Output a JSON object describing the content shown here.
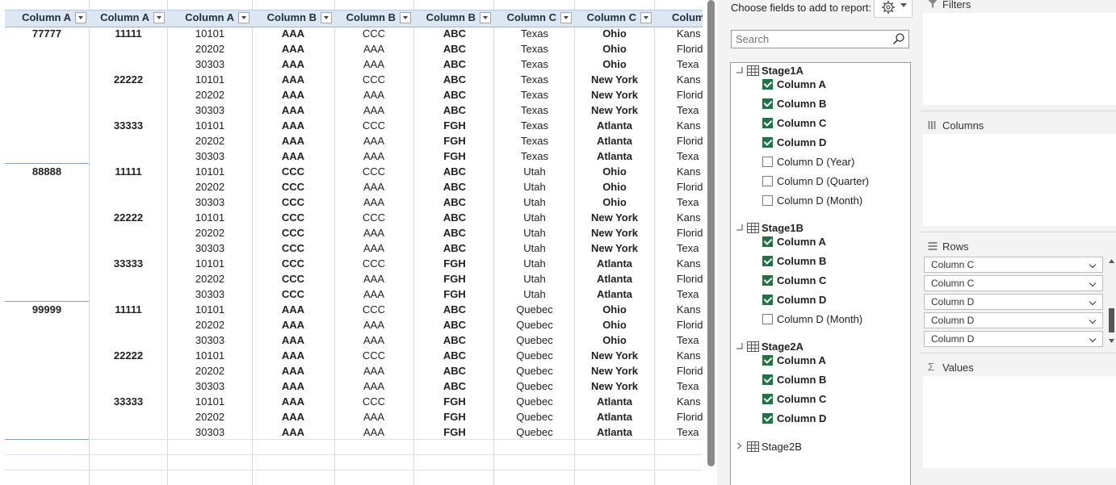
{
  "sheet": {
    "headers": [
      "Column A",
      "Column A",
      "Column A",
      "Column B",
      "Column B",
      "Column B",
      "Column C",
      "Column C",
      "Colum"
    ],
    "groups": [
      {
        "a1": "77777",
        "start": 0
      },
      {
        "a1": "88888",
        "start": 9
      },
      {
        "a1": "99999",
        "start": 18
      }
    ],
    "rows": [
      [
        "",
        "11111",
        "10101",
        "AAA",
        "CCC",
        "ABC",
        "Texas",
        "Ohio",
        "Kans"
      ],
      [
        "",
        "",
        "20202",
        "AAA",
        "AAA",
        "ABC",
        "Texas",
        "Ohio",
        "Florid"
      ],
      [
        "",
        "",
        "30303",
        "AAA",
        "AAA",
        "ABC",
        "Texas",
        "Ohio",
        "Texa"
      ],
      [
        "",
        "22222",
        "10101",
        "AAA",
        "CCC",
        "ABC",
        "Texas",
        "New York",
        "Kans"
      ],
      [
        "",
        "",
        "20202",
        "AAA",
        "AAA",
        "ABC",
        "Texas",
        "New York",
        "Florid"
      ],
      [
        "",
        "",
        "30303",
        "AAA",
        "AAA",
        "ABC",
        "Texas",
        "New York",
        "Texa"
      ],
      [
        "",
        "33333",
        "10101",
        "AAA",
        "CCC",
        "FGH",
        "Texas",
        "Atlanta",
        "Kans"
      ],
      [
        "",
        "",
        "20202",
        "AAA",
        "AAA",
        "FGH",
        "Texas",
        "Atlanta",
        "Florid"
      ],
      [
        "",
        "",
        "30303",
        "AAA",
        "AAA",
        "FGH",
        "Texas",
        "Atlanta",
        "Texa"
      ],
      [
        "",
        "11111",
        "10101",
        "CCC",
        "CCC",
        "ABC",
        "Utah",
        "Ohio",
        "Kans"
      ],
      [
        "",
        "",
        "20202",
        "CCC",
        "AAA",
        "ABC",
        "Utah",
        "Ohio",
        "Florid"
      ],
      [
        "",
        "",
        "30303",
        "CCC",
        "AAA",
        "ABC",
        "Utah",
        "Ohio",
        "Texa"
      ],
      [
        "",
        "22222",
        "10101",
        "CCC",
        "CCC",
        "ABC",
        "Utah",
        "New York",
        "Kans"
      ],
      [
        "",
        "",
        "20202",
        "CCC",
        "AAA",
        "ABC",
        "Utah",
        "New York",
        "Florid"
      ],
      [
        "",
        "",
        "30303",
        "CCC",
        "AAA",
        "ABC",
        "Utah",
        "New York",
        "Texa"
      ],
      [
        "",
        "33333",
        "10101",
        "CCC",
        "CCC",
        "FGH",
        "Utah",
        "Atlanta",
        "Kans"
      ],
      [
        "",
        "",
        "20202",
        "CCC",
        "AAA",
        "FGH",
        "Utah",
        "Atlanta",
        "Florid"
      ],
      [
        "",
        "",
        "30303",
        "CCC",
        "AAA",
        "FGH",
        "Utah",
        "Atlanta",
        "Texa"
      ],
      [
        "",
        "11111",
        "10101",
        "AAA",
        "CCC",
        "ABC",
        "Quebec",
        "Ohio",
        "Kans"
      ],
      [
        "",
        "",
        "20202",
        "AAA",
        "AAA",
        "ABC",
        "Quebec",
        "Ohio",
        "Florid"
      ],
      [
        "",
        "",
        "30303",
        "AAA",
        "AAA",
        "ABC",
        "Quebec",
        "Ohio",
        "Texa"
      ],
      [
        "",
        "22222",
        "10101",
        "AAA",
        "CCC",
        "ABC",
        "Quebec",
        "New York",
        "Kans"
      ],
      [
        "",
        "",
        "20202",
        "AAA",
        "AAA",
        "ABC",
        "Quebec",
        "New York",
        "Florid"
      ],
      [
        "",
        "",
        "30303",
        "AAA",
        "AAA",
        "ABC",
        "Quebec",
        "New York",
        "Texa"
      ],
      [
        "",
        "33333",
        "10101",
        "AAA",
        "CCC",
        "FGH",
        "Quebec",
        "Atlanta",
        "Kans"
      ],
      [
        "",
        "",
        "20202",
        "AAA",
        "AAA",
        "FGH",
        "Quebec",
        "Atlanta",
        "Florid"
      ],
      [
        "",
        "",
        "30303",
        "AAA",
        "AAA",
        "FGH",
        "Quebec",
        "Atlanta",
        "Texa"
      ]
    ]
  },
  "fieldlist": {
    "choose_label": "Choose fields to add to report:",
    "search_placeholder": "Search",
    "tables": [
      {
        "name": "Stage1A",
        "expanded": true,
        "fields": [
          {
            "label": "Column A",
            "checked": true
          },
          {
            "label": "Column B",
            "checked": true
          },
          {
            "label": "Column C",
            "checked": true
          },
          {
            "label": "Column D",
            "checked": true
          },
          {
            "label": "Column D (Year)",
            "checked": false
          },
          {
            "label": "Column D (Quarter)",
            "checked": false
          },
          {
            "label": "Column D (Month)",
            "checked": false
          }
        ]
      },
      {
        "name": "Stage1B",
        "expanded": true,
        "fields": [
          {
            "label": "Column A",
            "checked": true
          },
          {
            "label": "Column B",
            "checked": true
          },
          {
            "label": "Column C",
            "checked": true
          },
          {
            "label": "Column D",
            "checked": true
          },
          {
            "label": "Column D (Month)",
            "checked": false
          }
        ]
      },
      {
        "name": "Stage2A",
        "expanded": true,
        "fields": [
          {
            "label": "Column A",
            "checked": true
          },
          {
            "label": "Column B",
            "checked": true
          },
          {
            "label": "Column C",
            "checked": true
          },
          {
            "label": "Column D",
            "checked": true
          }
        ]
      },
      {
        "name": "Stage2B",
        "expanded": false,
        "fields": []
      }
    ]
  },
  "areas": {
    "filters_label": "Filters",
    "columns_label": "Columns",
    "rows_label": "Rows",
    "values_label": "Values",
    "rows": [
      "Column C",
      "Column C",
      "Column D",
      "Column D",
      "Column D"
    ]
  },
  "colors": {
    "header_bg": "#dde7f3",
    "checkbox_green": "#217346",
    "pane_bg": "#f3f3f3"
  }
}
